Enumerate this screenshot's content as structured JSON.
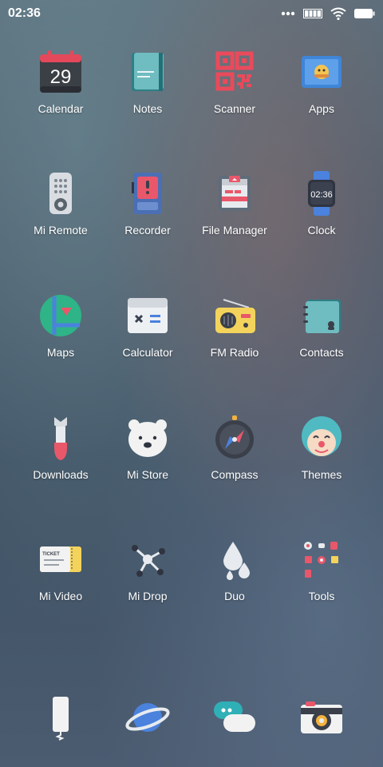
{
  "status_bar": {
    "time": "02:36"
  },
  "apps": [
    {
      "label": "Calendar",
      "icon": "calendar-icon",
      "date": "29"
    },
    {
      "label": "Notes",
      "icon": "notes-icon"
    },
    {
      "label": "Scanner",
      "icon": "qr-scanner-icon"
    },
    {
      "label": "Apps",
      "icon": "app-store-icon"
    },
    {
      "label": "Mi Remote",
      "icon": "remote-icon"
    },
    {
      "label": "Recorder",
      "icon": "cassette-recorder-icon"
    },
    {
      "label": "File Manager",
      "icon": "file-manager-icon"
    },
    {
      "label": "Clock",
      "icon": "watch-icon",
      "time": "02:36"
    },
    {
      "label": "Maps",
      "icon": "map-icon"
    },
    {
      "label": "Calculator",
      "icon": "calculator-icon"
    },
    {
      "label": "FM Radio",
      "icon": "radio-icon"
    },
    {
      "label": "Contacts",
      "icon": "contacts-book-icon"
    },
    {
      "label": "Downloads",
      "icon": "rocket-download-icon"
    },
    {
      "label": "Mi Store",
      "icon": "polar-bear-icon"
    },
    {
      "label": "Compass",
      "icon": "compass-icon"
    },
    {
      "label": "Themes",
      "icon": "clown-themes-icon"
    },
    {
      "label": "Mi Video",
      "icon": "ticket-video-icon",
      "ticket_text": "TICKET"
    },
    {
      "label": "Mi Drop",
      "icon": "share-nodes-icon"
    },
    {
      "label": "Duo",
      "icon": "water-drops-icon"
    },
    {
      "label": "Tools",
      "icon": "tools-folder-icon"
    }
  ],
  "dock": [
    {
      "icon": "phone-icon"
    },
    {
      "icon": "planet-browser-icon"
    },
    {
      "icon": "chat-bubbles-icon"
    },
    {
      "icon": "camera-icon"
    }
  ]
}
